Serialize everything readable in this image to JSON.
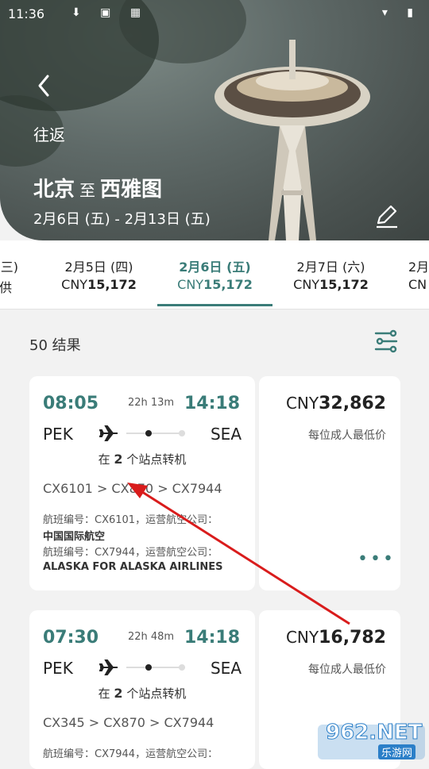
{
  "status_bar": {
    "time": "11:36",
    "left_icons": "⬇ ▣ ▦",
    "right_icons": "▾ ▮"
  },
  "header": {
    "trip_type": "往返",
    "origin": "北京",
    "to_word": "至",
    "destination": "西雅图",
    "dates": "2月6日 (五) - 2月13日 (五)",
    "back_icon": "chevron-left-icon",
    "edit_icon": "pencil-icon"
  },
  "date_tabs": [
    {
      "date": "(三)",
      "price_prefix": "",
      "price": "",
      "extra": "供"
    },
    {
      "date": "2月5日 (四)",
      "price_prefix": "CNY",
      "price": "15,172"
    },
    {
      "date": "2月6日 (五)",
      "price_prefix": "CNY",
      "price": "15,172",
      "active": true
    },
    {
      "date": "2月7日 (六)",
      "price_prefix": "CNY",
      "price": "15,172"
    },
    {
      "date": "2月",
      "price_prefix": "CN",
      "price": ""
    }
  ],
  "results": {
    "label": "50 结果",
    "filter_icon": "sliders-icon"
  },
  "flights": [
    {
      "depart": "08:05",
      "duration": "22h 13m",
      "arrive": "14:18",
      "from": "PEK",
      "to": "SEA",
      "stops_prefix": "在 ",
      "stops_count": "2",
      "stops_suffix": " 个站点转机",
      "route": "CX6101 > CX870 > CX7944",
      "info1": "航班编号：CX6101，运营航空公司：",
      "carrier1": "中国国际航空",
      "info2": "航班编号：CX7944，运营航空公司：",
      "carrier2": "ALASKA FOR ALASKA AIRLINES",
      "price_prefix": "CNY",
      "price": "32,862",
      "price_note": "每位成人最低价",
      "more": "•••"
    },
    {
      "depart": "07:30",
      "duration": "22h 48m",
      "arrive": "14:18",
      "from": "PEK",
      "to": "SEA",
      "stops_prefix": "在 ",
      "stops_count": "2",
      "stops_suffix": " 个站点转机",
      "route": "CX345 > CX870 > CX7944",
      "info1": "航班编号：CX7944，运营航空公司：",
      "price_prefix": "CNY",
      "price": "16,782",
      "price_note": "每位成人最低价"
    }
  ],
  "watermark": {
    "main": "962.NET",
    "sub": "乐游网"
  },
  "colors": {
    "accent": "#3a7c78",
    "annotation_arrow": "#d91c1c"
  }
}
